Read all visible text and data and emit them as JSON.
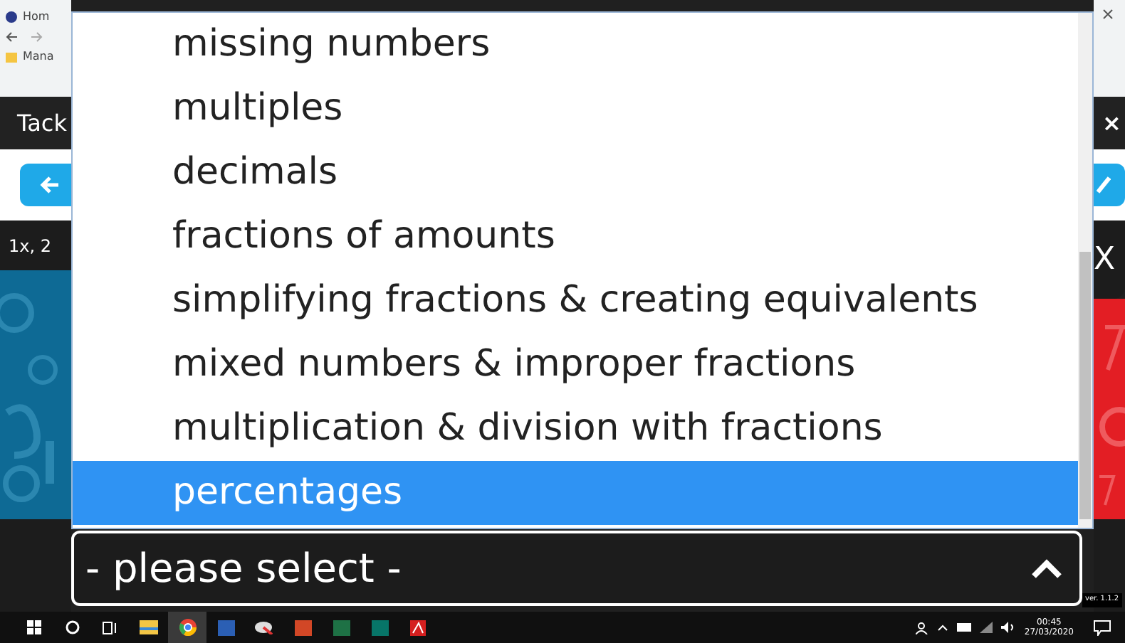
{
  "browser": {
    "tab_title": "Hom",
    "bookmark": "Mana"
  },
  "app": {
    "header_title": "Tack",
    "subtitle": "1x, 2",
    "close_label": "×",
    "panel_close": "X",
    "version": "ver. 1.1.2"
  },
  "dropdown": {
    "expanded": true,
    "value": "- please select -",
    "options": [
      {
        "label": "missing numbers",
        "selected": false
      },
      {
        "label": "multiples",
        "selected": false
      },
      {
        "label": "decimals",
        "selected": false
      },
      {
        "label": "fractions of amounts",
        "selected": false
      },
      {
        "label": "simplifying fractions & creating equivalents",
        "selected": false
      },
      {
        "label": "mixed numbers & improper fractions",
        "selected": false
      },
      {
        "label": "multiplication & division with fractions",
        "selected": false
      },
      {
        "label": "percentages",
        "selected": true
      }
    ]
  },
  "taskbar": {
    "time": "00:45",
    "date": "27/03/2020"
  }
}
